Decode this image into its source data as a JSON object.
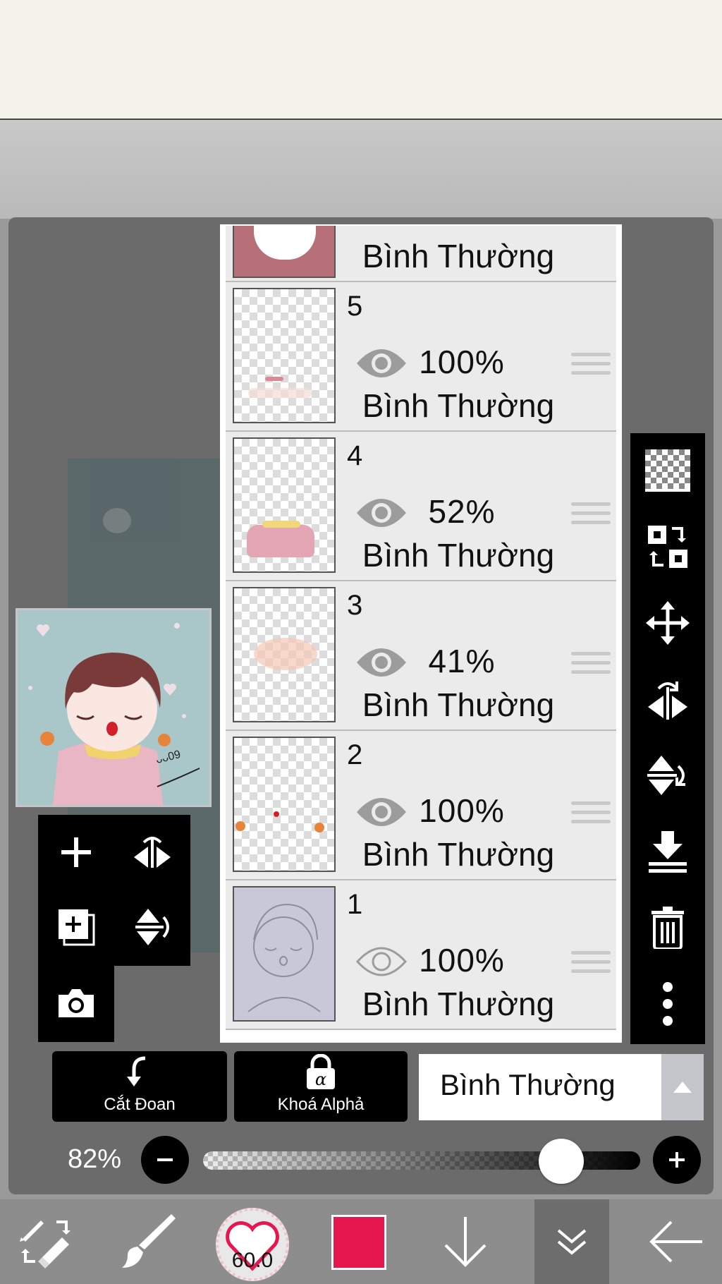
{
  "layers_panel": {
    "partial_top_layer": {
      "blend_mode": "Bình Thường"
    },
    "layers": [
      {
        "number": "5",
        "opacity": "100%",
        "blend_mode": "Bình Thường",
        "visible": true
      },
      {
        "number": "4",
        "opacity": "52%",
        "blend_mode": "Bình Thường",
        "visible": true
      },
      {
        "number": "3",
        "opacity": "41%",
        "blend_mode": "Bình Thường",
        "visible": true
      },
      {
        "number": "2",
        "opacity": "100%",
        "blend_mode": "Bình Thường",
        "visible": true
      },
      {
        "number": "1",
        "opacity": "100%",
        "blend_mode": "Bình Thường",
        "visible": false
      }
    ]
  },
  "thumbnail": {
    "signature": "ᴗᴗ09"
  },
  "layer_controls": {
    "clipping_label": "Cắt Đoan",
    "alpha_lock_label": "Khoá Alphả",
    "blend_mode_selected": "Bình Thường"
  },
  "opacity_slider": {
    "value_label": "82%",
    "value": 0.82
  },
  "bottom_toolbar": {
    "brush_size": "60.0",
    "current_color": "#e6174f"
  },
  "icons": {
    "mini_toolbar": [
      "plus-icon",
      "flip-horizontal-icon",
      "add-layer-copy-icon",
      "flip-vertical-icon",
      "camera-icon"
    ],
    "right_toolbar": [
      "transparent-checker-icon",
      "swap-layers-icon",
      "move-icon",
      "flip-horizontal-icon",
      "flip-vertical-icon",
      "merge-down-icon",
      "trash-icon",
      "more-vertical-icon"
    ],
    "bottom_toolbar": [
      "pen-eraser-swap-icon",
      "brush-icon",
      "brush-size-heart-icon",
      "color-swatch",
      "arrow-down-icon",
      "chevron-double-down-icon",
      "arrow-left-icon"
    ]
  }
}
